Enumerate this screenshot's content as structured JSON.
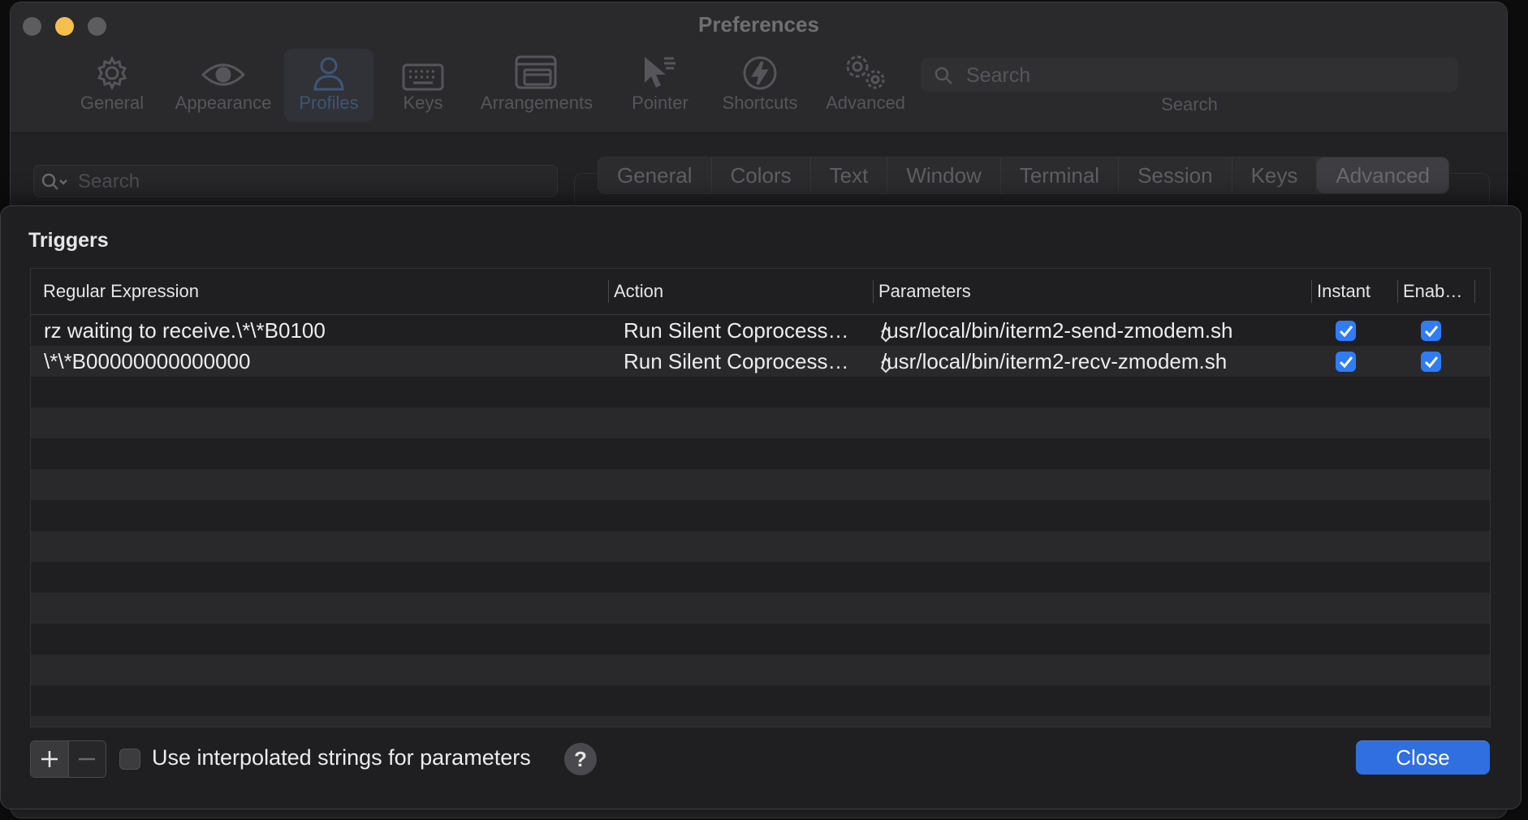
{
  "window": {
    "title": "Preferences"
  },
  "toolbar": {
    "items": [
      {
        "label": "General",
        "icon": "gear-icon"
      },
      {
        "label": "Appearance",
        "icon": "eye-icon"
      },
      {
        "label": "Profiles",
        "icon": "person-icon",
        "active": true
      },
      {
        "label": "Keys",
        "icon": "keyboard-icon"
      },
      {
        "label": "Arrangements",
        "icon": "windows-icon"
      },
      {
        "label": "Pointer",
        "icon": "pointer-icon"
      },
      {
        "label": "Shortcuts",
        "icon": "lightning-icon"
      },
      {
        "label": "Advanced",
        "icon": "gears-icon"
      }
    ],
    "search": {
      "placeholder": "Search",
      "label": "Search"
    }
  },
  "profiles": {
    "search_placeholder": "Search"
  },
  "tabs": [
    "General",
    "Colors",
    "Text",
    "Window",
    "Terminal",
    "Session",
    "Keys",
    "Advanced"
  ],
  "active_tab": "Advanced",
  "triggers": {
    "title": "Triggers",
    "columns": {
      "regex": "Regular Expression",
      "action": "Action",
      "parameters": "Parameters",
      "instant": "Instant",
      "enabled": "Enab…"
    },
    "rows": [
      {
        "regex": "rz waiting to receive.\\*\\*B0100",
        "action": "Run Silent Coprocess…",
        "parameters": "/usr/local/bin/iterm2-send-zmodem.sh",
        "instant": true,
        "enabled": true
      },
      {
        "regex": "\\*\\*B00000000000000",
        "action": "Run Silent Coprocess…",
        "parameters": "/usr/local/bin/iterm2-recv-zmodem.sh",
        "instant": true,
        "enabled": true
      }
    ],
    "interpolated_label": "Use interpolated strings for parameters",
    "interpolated_checked": false,
    "help_label": "?",
    "close_label": "Close"
  },
  "colors": {
    "accent": "#2f7cf6",
    "close_button": "#2f6fe0",
    "minimize": "#f5bf4f"
  }
}
